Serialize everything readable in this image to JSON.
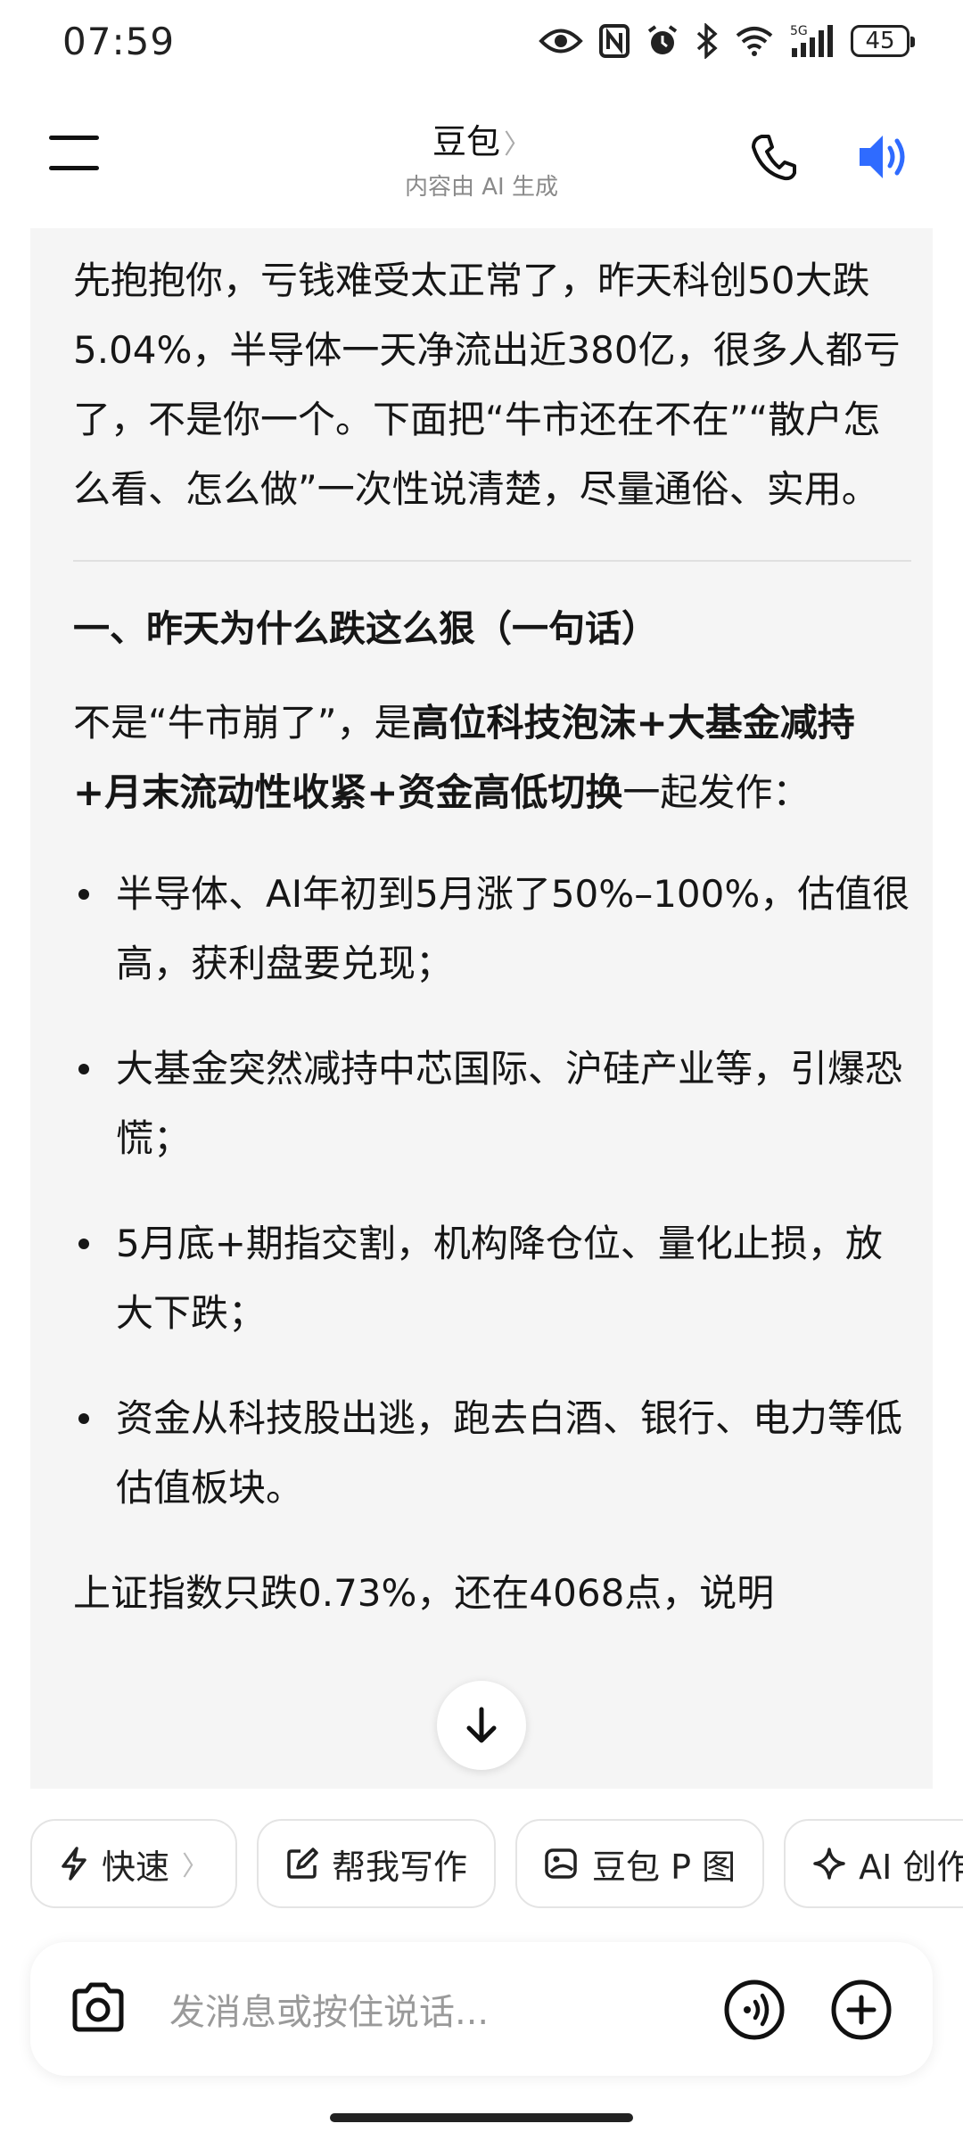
{
  "status_bar": {
    "time": "07:59",
    "battery": "45",
    "network": "5G"
  },
  "header": {
    "title": "豆包",
    "subtitle": "内容由 AI 生成"
  },
  "message": {
    "intro": "先抱抱你，亏钱难受太正常了，昨天科创50大跌5.04%，半导体一天净流出近380亿，很多人都亏了，不是你一个。下面把“牛市还在不在”“散户怎么看、怎么做”一次性说清楚，尽量通俗、实用。",
    "section1_title": "一、昨天为什么跌这么狠（一句话）",
    "para_prefix": "不是“牛市崩了”，是",
    "para_bold": "高位科技泡沫+大基金减持+月末流动性收紧+资金高低切换",
    "para_suffix": "一起发作：",
    "bullets": [
      "半导体、AI年初到5月涨了50%–100%，估值很高，获利盘要兑现；",
      "大基金突然减持中芯国际、沪硅产业等，引爆恐慌；",
      "5月底+期指交割，机构降仓位、量化止损，放大下跌；",
      "资金从科技股出逃，跑去白酒、银行、电力等低估值板块。"
    ],
    "partial_line": "上证指数只跌0.73%，还在4068点，说明"
  },
  "chips": [
    {
      "label": "快速",
      "icon": "lightning-icon"
    },
    {
      "label": "帮我写作",
      "icon": "edit-icon"
    },
    {
      "label": "豆包 P 图",
      "icon": "image-edit-icon"
    },
    {
      "label": "AI 创作",
      "icon": "sparkle-icon"
    }
  ],
  "input": {
    "placeholder": "发消息或按住说话..."
  },
  "colors": {
    "accent": "#2f6bff",
    "card_bg": "#f5f5f5"
  }
}
